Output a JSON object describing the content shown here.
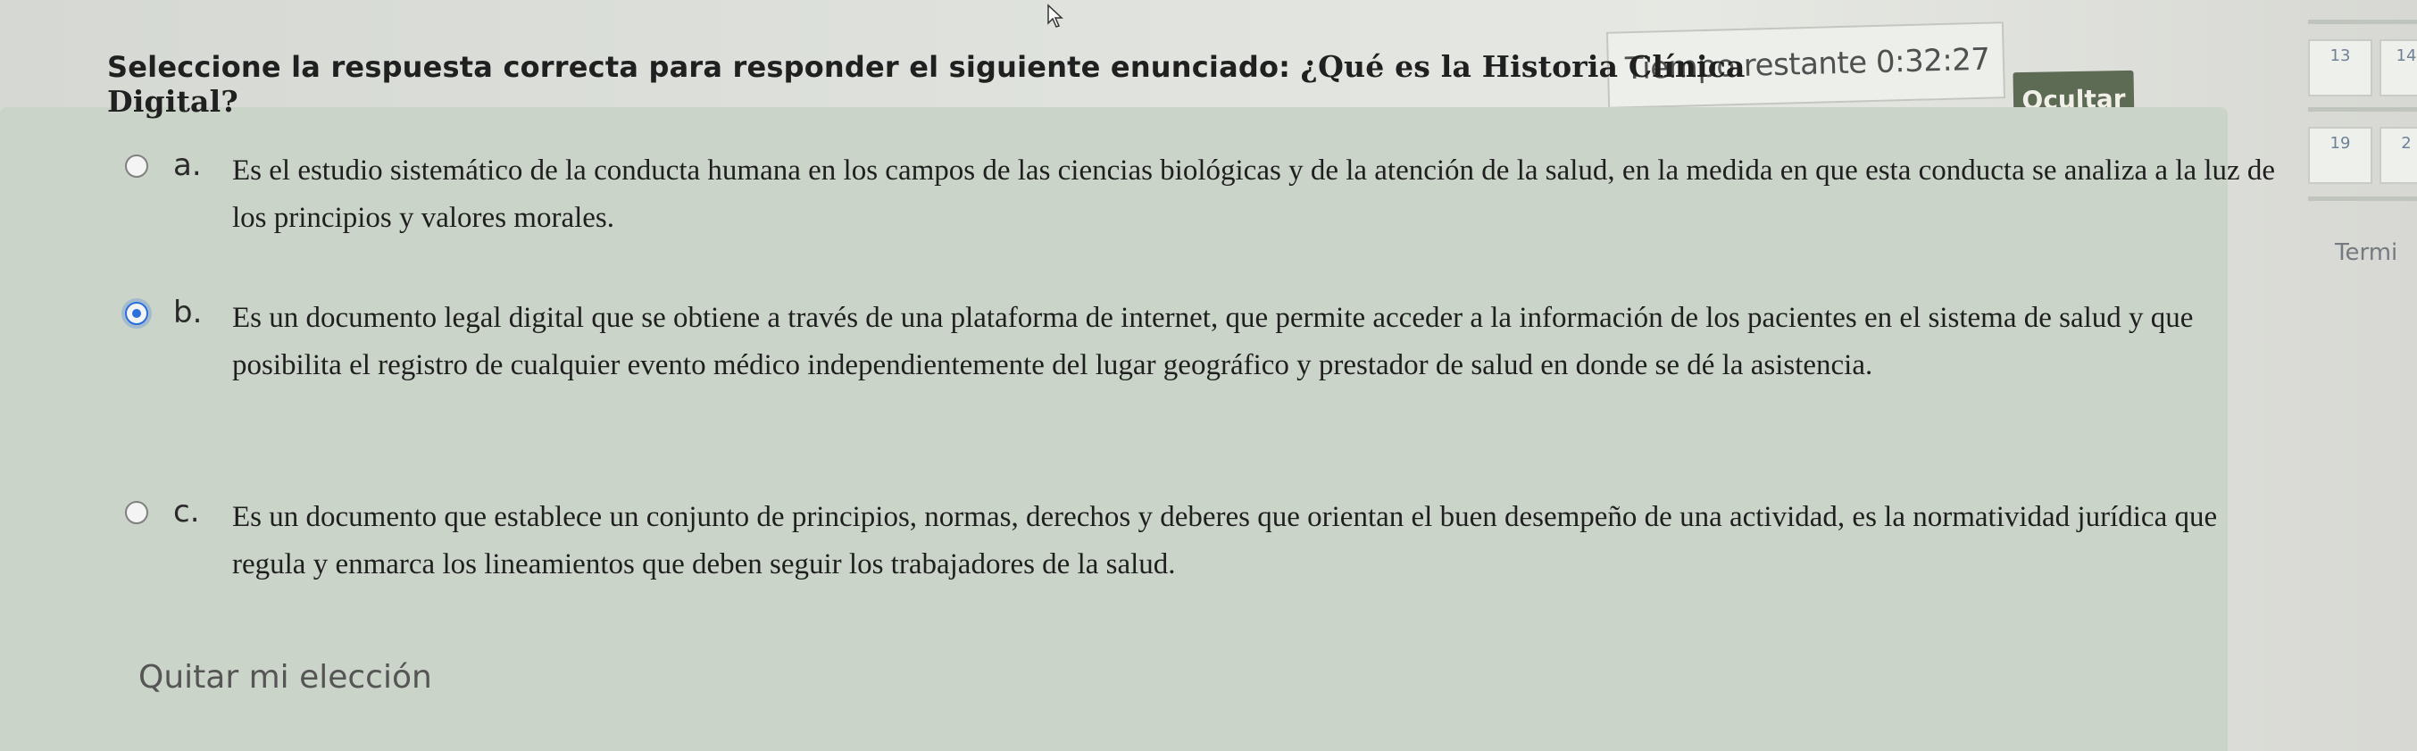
{
  "header": {
    "timer_label": "Tiempo restante 0:32:27",
    "hide_button": "Ocultar"
  },
  "question": {
    "prompt_lead": "Seleccione la respuesta correcta para responder el siguiente enunciado:",
    "prompt_question": "¿Qué es la Historia Clínica Digital?"
  },
  "options": [
    {
      "letter": "a.",
      "text": "Es el estudio sistemático de la conducta humana en los campos de las ciencias biológicas y de la atención de la salud, en la medida en que esta conducta se analiza a la luz de los principios y valores morales.",
      "selected": false
    },
    {
      "letter": "b.",
      "text": "Es un documento legal digital que se obtiene a través de una plataforma de internet, que permite acceder a la información de los pacientes en el sistema de salud y que posibilita el registro de cualquier evento médico independientemente del lugar geográfico y prestador de salud en donde se dé la asistencia.",
      "selected": true
    },
    {
      "letter": "c.",
      "text": "Es un documento que establece un conjunto de principios, normas, derechos y deberes que orientan el buen desempeño de una actividad, es la normatividad jurídica que regula y enmarca los lineamientos que deben seguir los trabajadores de la salud.",
      "selected": false
    }
  ],
  "clear_choice": "Quitar mi elección",
  "quiz_nav": {
    "cells": [
      "13",
      "14",
      "19",
      "2"
    ],
    "finish_label": "Termi"
  },
  "colors": {
    "card": "#cbd4c9",
    "hide_button": "#5d6a54",
    "radio_selected": "#2a6fdb"
  }
}
